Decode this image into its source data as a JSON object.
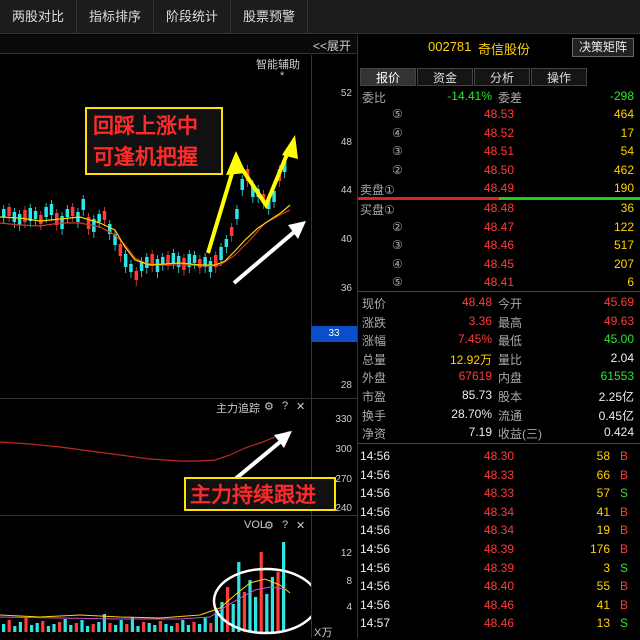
{
  "top_tabs": [
    "两股对比",
    "指标排序",
    "阶段统计",
    "股票预警"
  ],
  "left_panel": {
    "expand_label": "<<展开",
    "indicator_label": "智能辅助",
    "indicator_star": "*",
    "price_axis": [
      "52",
      "48",
      "44",
      "40",
      "36",
      "28"
    ],
    "price_badge": "33",
    "tracker_title": "主力追踪",
    "tracker_axis": [
      "330",
      "300",
      "270",
      "240"
    ],
    "vol_title": "VOL",
    "vol_axis": [
      "12",
      "8",
      "4"
    ],
    "vol_unit": "X万",
    "annotation_top": [
      "回踩上涨中",
      "可逢机把握"
    ],
    "annotation_mid": "主力持续跟进",
    "icons": [
      "gear-icon",
      "question-icon",
      "close-icon"
    ],
    "colors": {
      "up": "#ff3b3b",
      "down": "#2ee5e5",
      "ma_yellow": "#ffd400",
      "ma_red": "#d4372c",
      "arrow_yellow": "#ffff00",
      "arrow_white": "#ffffff"
    }
  },
  "stock": {
    "code": "002781",
    "name": "奇信股份",
    "button": "决策矩阵"
  },
  "subtabs": [
    "报价",
    "资金",
    "分析",
    "操作"
  ],
  "quote": {
    "weibi_label": "委比",
    "weibi_value": "-14.41%",
    "weicha_label": "委差",
    "weicha_value": "-298",
    "sell": [
      {
        "label": "⑤",
        "price": "48.53",
        "vol": "464"
      },
      {
        "label": "④",
        "price": "48.52",
        "vol": "17"
      },
      {
        "label": "③",
        "price": "48.51",
        "vol": "54"
      },
      {
        "label": "②",
        "price": "48.50",
        "vol": "462"
      },
      {
        "label": "卖盘①",
        "price": "48.49",
        "vol": "190"
      }
    ],
    "buy": [
      {
        "label": "买盘①",
        "price": "48.48",
        "vol": "36"
      },
      {
        "label": "②",
        "price": "48.47",
        "vol": "122"
      },
      {
        "label": "③",
        "price": "48.46",
        "vol": "517"
      },
      {
        "label": "④",
        "price": "48.45",
        "vol": "207"
      },
      {
        "label": "⑤",
        "price": "48.41",
        "vol": "6"
      }
    ]
  },
  "stats": [
    {
      "l1": "现价",
      "v1": "48.48",
      "c1": "red",
      "l2": "今开",
      "v2": "45.69",
      "c2": "red"
    },
    {
      "l1": "涨跌",
      "v1": "3.36",
      "c1": "red",
      "l2": "最高",
      "v2": "49.63",
      "c2": "red"
    },
    {
      "l1": "涨幅",
      "v1": "7.45%",
      "c1": "red",
      "l2": "最低",
      "v2": "45.00",
      "c2": "green"
    },
    {
      "l1": "总量",
      "v1": "12.92万",
      "c1": "yellow",
      "l2": "量比",
      "v2": "2.04",
      "c2": "white"
    },
    {
      "l1": "外盘",
      "v1": "67619",
      "c1": "red",
      "l2": "内盘",
      "v2": "61553",
      "c2": "green"
    },
    {
      "l1": "市盈",
      "v1": "85.73",
      "c1": "white",
      "l2": "股本",
      "v2": "2.25亿",
      "c2": "white"
    },
    {
      "l1": "换手",
      "v1": "28.70%",
      "c1": "white",
      "l2": "流通",
      "v2": "0.45亿",
      "c2": "white"
    },
    {
      "l1": "净资",
      "v1": "7.19",
      "c1": "white",
      "l2": "收益(三)",
      "v2": "0.424",
      "c2": "white"
    }
  ],
  "ticks": [
    {
      "time": "14:56",
      "price": "48.30",
      "vol": "58",
      "dir": "B"
    },
    {
      "time": "14:56",
      "price": "48.33",
      "vol": "66",
      "dir": "B"
    },
    {
      "time": "14:56",
      "price": "48.33",
      "vol": "57",
      "dir": "S"
    },
    {
      "time": "14:56",
      "price": "48.34",
      "vol": "41",
      "dir": "B"
    },
    {
      "time": "14:56",
      "price": "48.34",
      "vol": "19",
      "dir": "B"
    },
    {
      "time": "14:56",
      "price": "48.39",
      "vol": "176",
      "dir": "B"
    },
    {
      "time": "14:56",
      "price": "48.39",
      "vol": "3",
      "dir": "S"
    },
    {
      "time": "14:56",
      "price": "48.40",
      "vol": "55",
      "dir": "B"
    },
    {
      "time": "14:56",
      "price": "48.46",
      "vol": "41",
      "dir": "B"
    },
    {
      "time": "14:57",
      "price": "48.46",
      "vol": "13",
      "dir": "S"
    }
  ]
}
